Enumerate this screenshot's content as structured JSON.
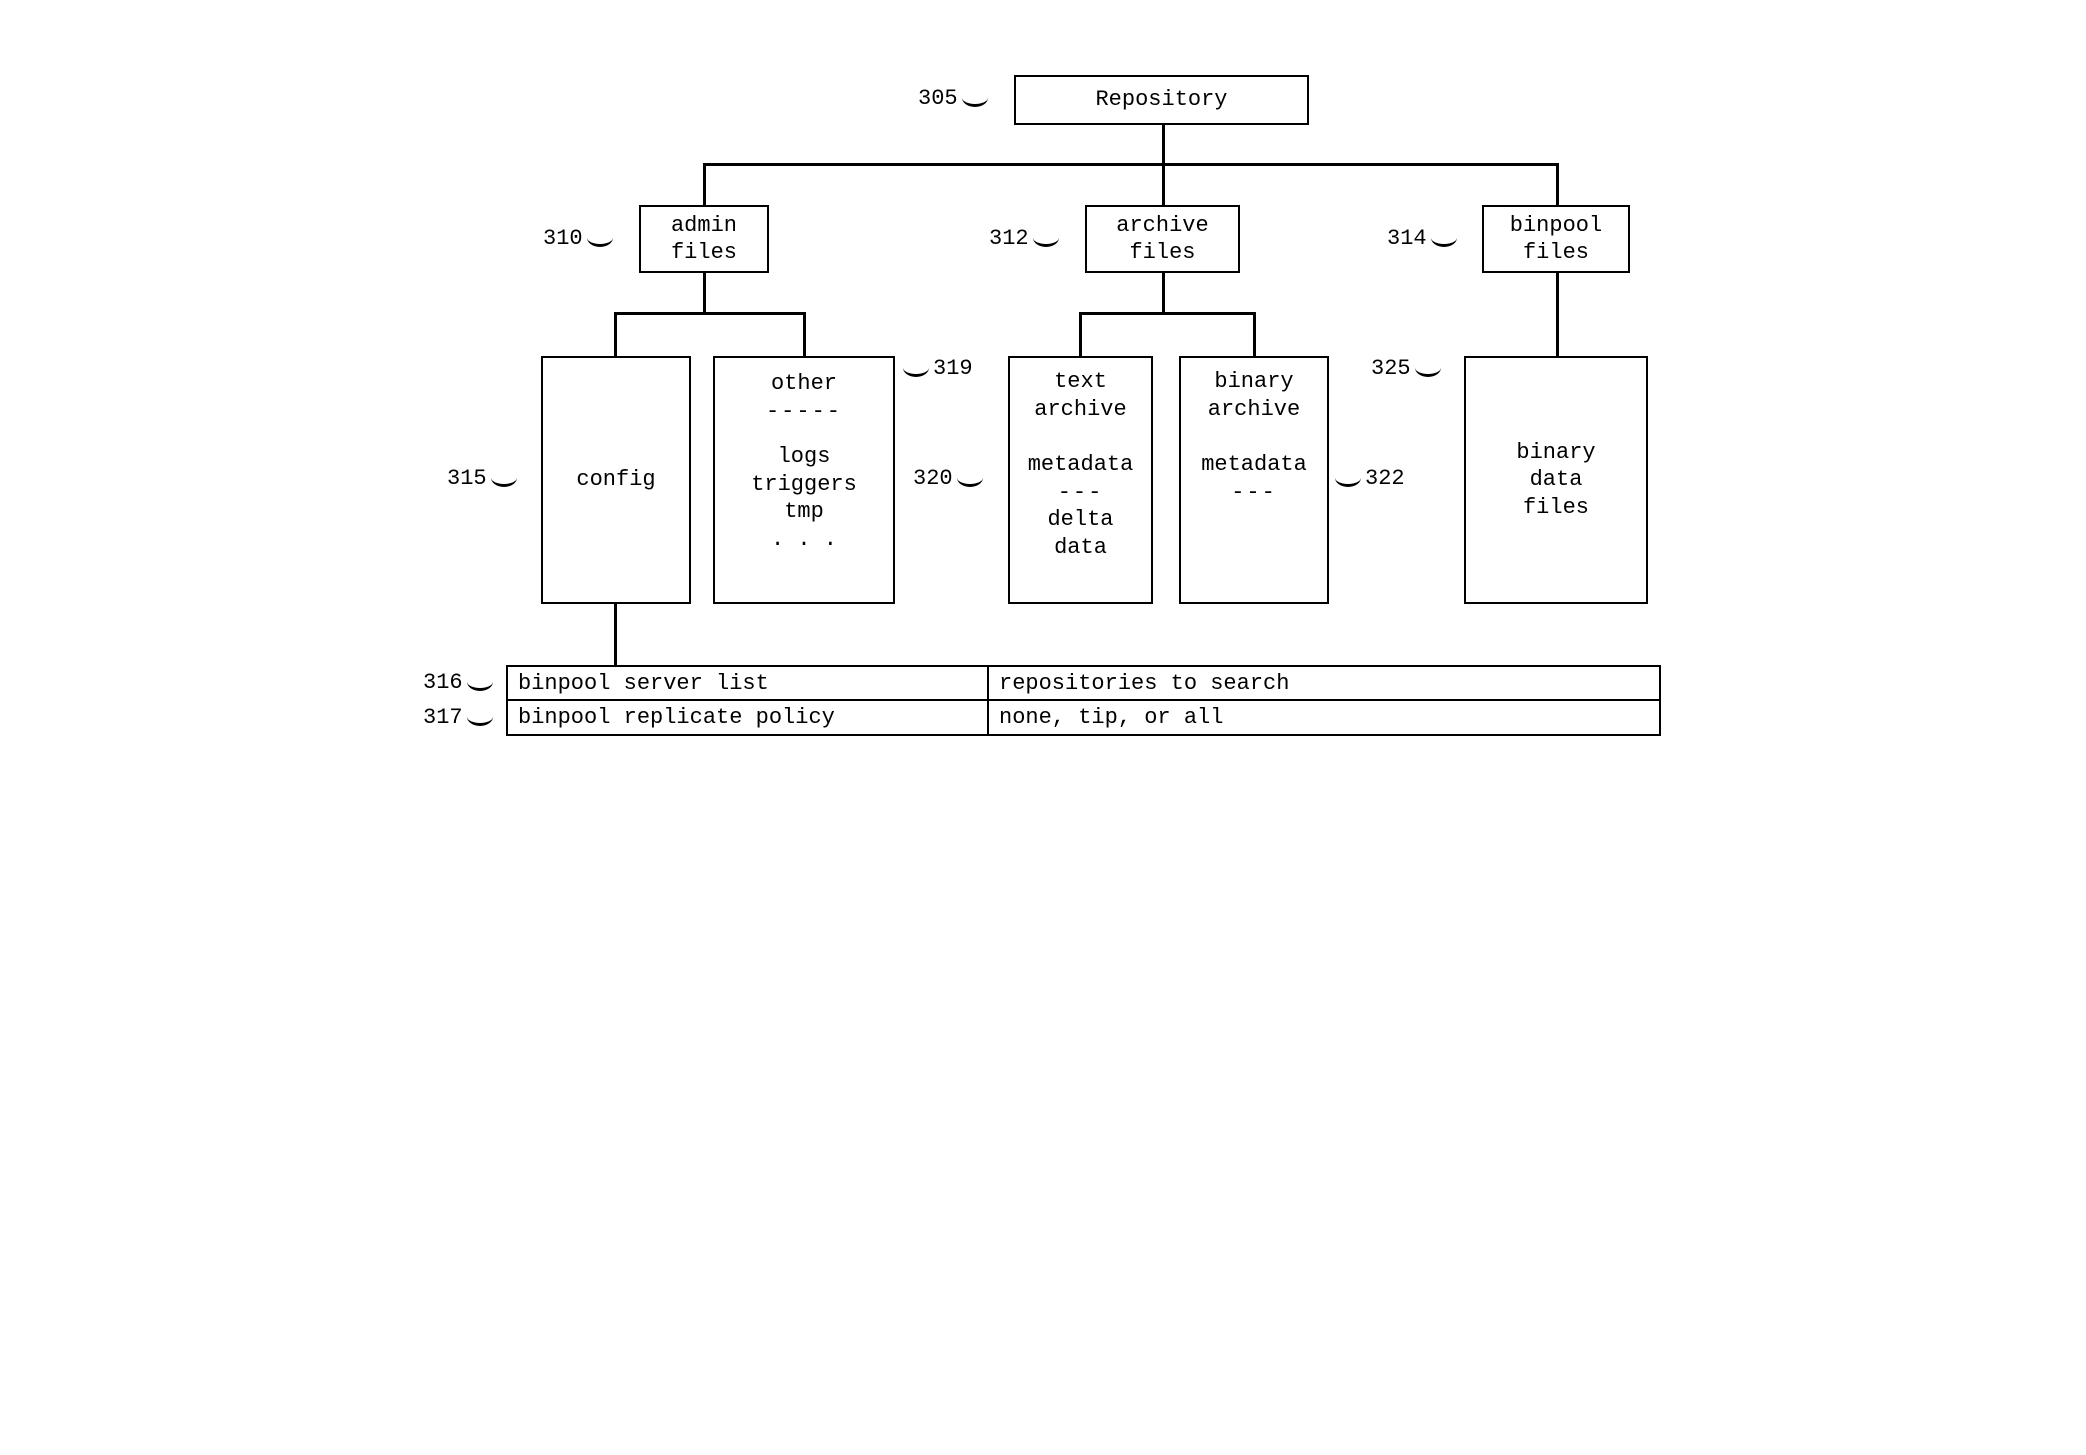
{
  "nodes": {
    "repository": "Repository",
    "admin_files": {
      "l1": "admin",
      "l2": "files"
    },
    "archive_files": {
      "l1": "archive",
      "l2": "files"
    },
    "binpool_files": {
      "l1": "binpool",
      "l2": "files"
    },
    "config": "config",
    "other": {
      "title": "other",
      "sep": "-----",
      "l1": "logs",
      "l2": "triggers",
      "l3": "tmp",
      "l4": ". . ."
    },
    "text_archive": {
      "l1": "text",
      "l2": "archive",
      "gap": "",
      "m": "metadata",
      "sep": "---",
      "d1": "delta",
      "d2": "data"
    },
    "binary_archive": {
      "l1": "binary",
      "l2": "archive",
      "gap": "",
      "m": "metadata",
      "sep": "---"
    },
    "binary_data_files": {
      "l1": "binary",
      "l2": "data",
      "l3": "files"
    }
  },
  "labels": {
    "n305": "305",
    "n310": "310",
    "n312": "312",
    "n314": "314",
    "n315": "315",
    "n319": "319",
    "n320": "320",
    "n322": "322",
    "n325": "325",
    "n316": "316",
    "n317": "317"
  },
  "table": {
    "r1c1": "binpool server list",
    "r1c2": "repositories to search",
    "r2c1": "binpool replicate policy",
    "r2c2": "none, tip, or all"
  }
}
